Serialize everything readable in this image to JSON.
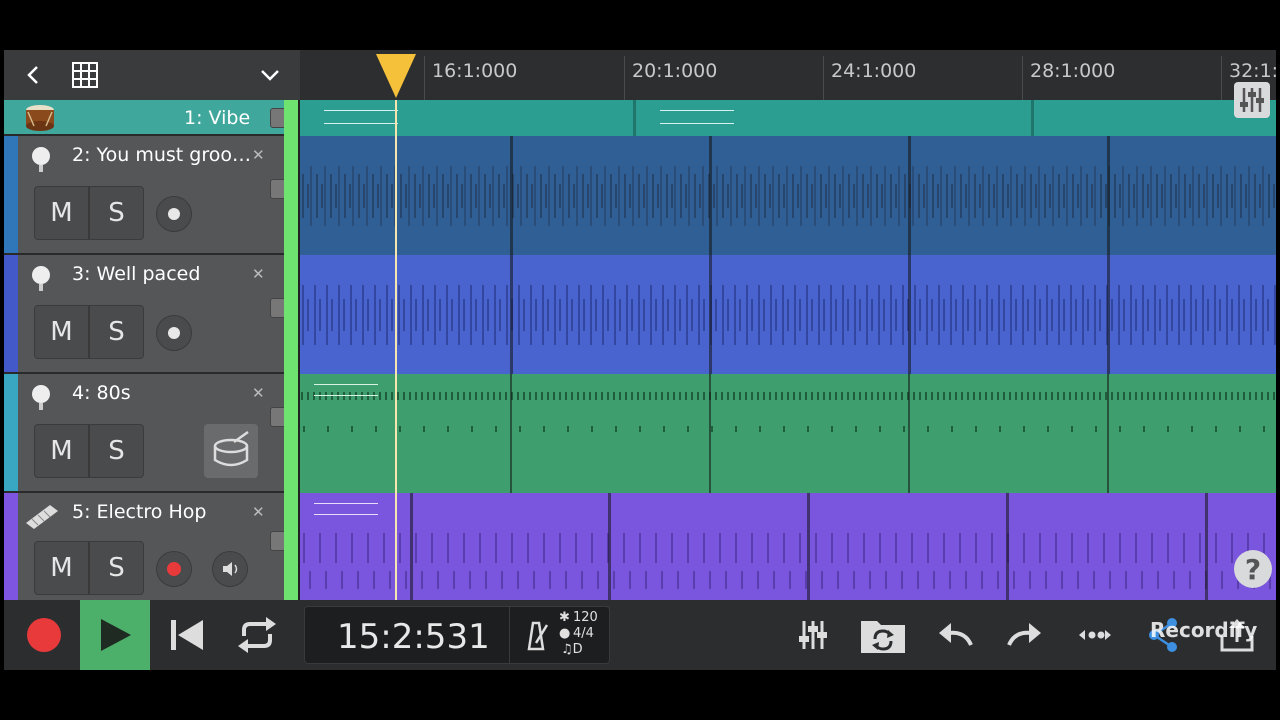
{
  "header": {
    "back_icon": "chevron-left-icon",
    "grid_icon": "grid-icon",
    "dropdown_icon": "chevron-down-icon"
  },
  "ruler": {
    "marks": [
      "16:1:000",
      "20:1:000",
      "24:1:000",
      "28:1:000",
      "32:1:"
    ]
  },
  "tracks": [
    {
      "label": "1: Vibe",
      "color": "#2fa59a",
      "lane_color": "#2b9d91",
      "icon": "drum-instrument-icon"
    },
    {
      "label": "2: You must groo…",
      "color": "#2f77b8",
      "lane_color": "#2f5f95",
      "mute": "M",
      "solo": "S",
      "icon": "microphone-icon"
    },
    {
      "label": "3: Well paced",
      "color": "#4359c9",
      "lane_color": "#4964cf",
      "mute": "M",
      "solo": "S",
      "icon": "microphone-icon"
    },
    {
      "label": "4: 80s",
      "color": "#3aa7c2",
      "lane_color": "#3e9e6e",
      "mute": "M",
      "solo": "S",
      "icon": "microphone-icon",
      "tool_icon": "drum-icon"
    },
    {
      "label": "5: Electro Hop",
      "color": "#7d55e0",
      "lane_color": "#7a55dd",
      "mute": "M",
      "solo": "S",
      "icon": "keyboard-icon",
      "tool_icon": "speaker-icon"
    }
  ],
  "transport": {
    "position": "15:2:531",
    "tempo": "120",
    "time_signature": "4/4",
    "note": "♫D"
  },
  "watermark": "Recordify",
  "colors": {
    "record": "#e8393b",
    "play_bg": "#4caf6a",
    "playhead": "#f6c13a"
  }
}
